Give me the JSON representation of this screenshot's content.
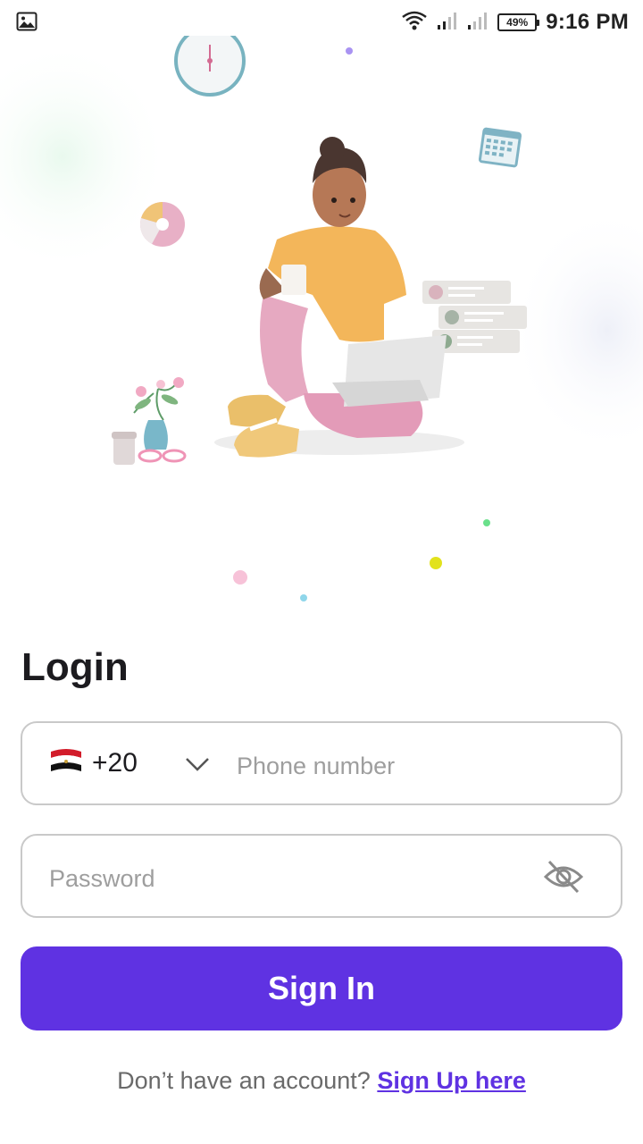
{
  "status_bar": {
    "battery": "49%",
    "time": "9:16 PM",
    "gallery_icon": "image-icon",
    "wifi_icon": "wifi-icon",
    "signal_icon": "cell-signal-icon"
  },
  "illustration": {
    "icon": "person-with-laptop-illustration"
  },
  "login": {
    "title": "Login",
    "phone": {
      "country_flag": "egypt-flag-icon",
      "country_code": "+20",
      "dropdown_icon": "chevron-down-icon",
      "placeholder": "Phone number",
      "value": ""
    },
    "password": {
      "placeholder": "Password",
      "value": "",
      "visibility_icon": "eye-off-icon"
    },
    "signin_label": "Sign In",
    "footer_text": "Don’t have an account?",
    "signup_link": "Sign Up here"
  },
  "colors": {
    "primary": "#5f32e2",
    "border": "#c9c9c9",
    "text": "#1c1b1f",
    "muted": "#6a6a6a"
  }
}
